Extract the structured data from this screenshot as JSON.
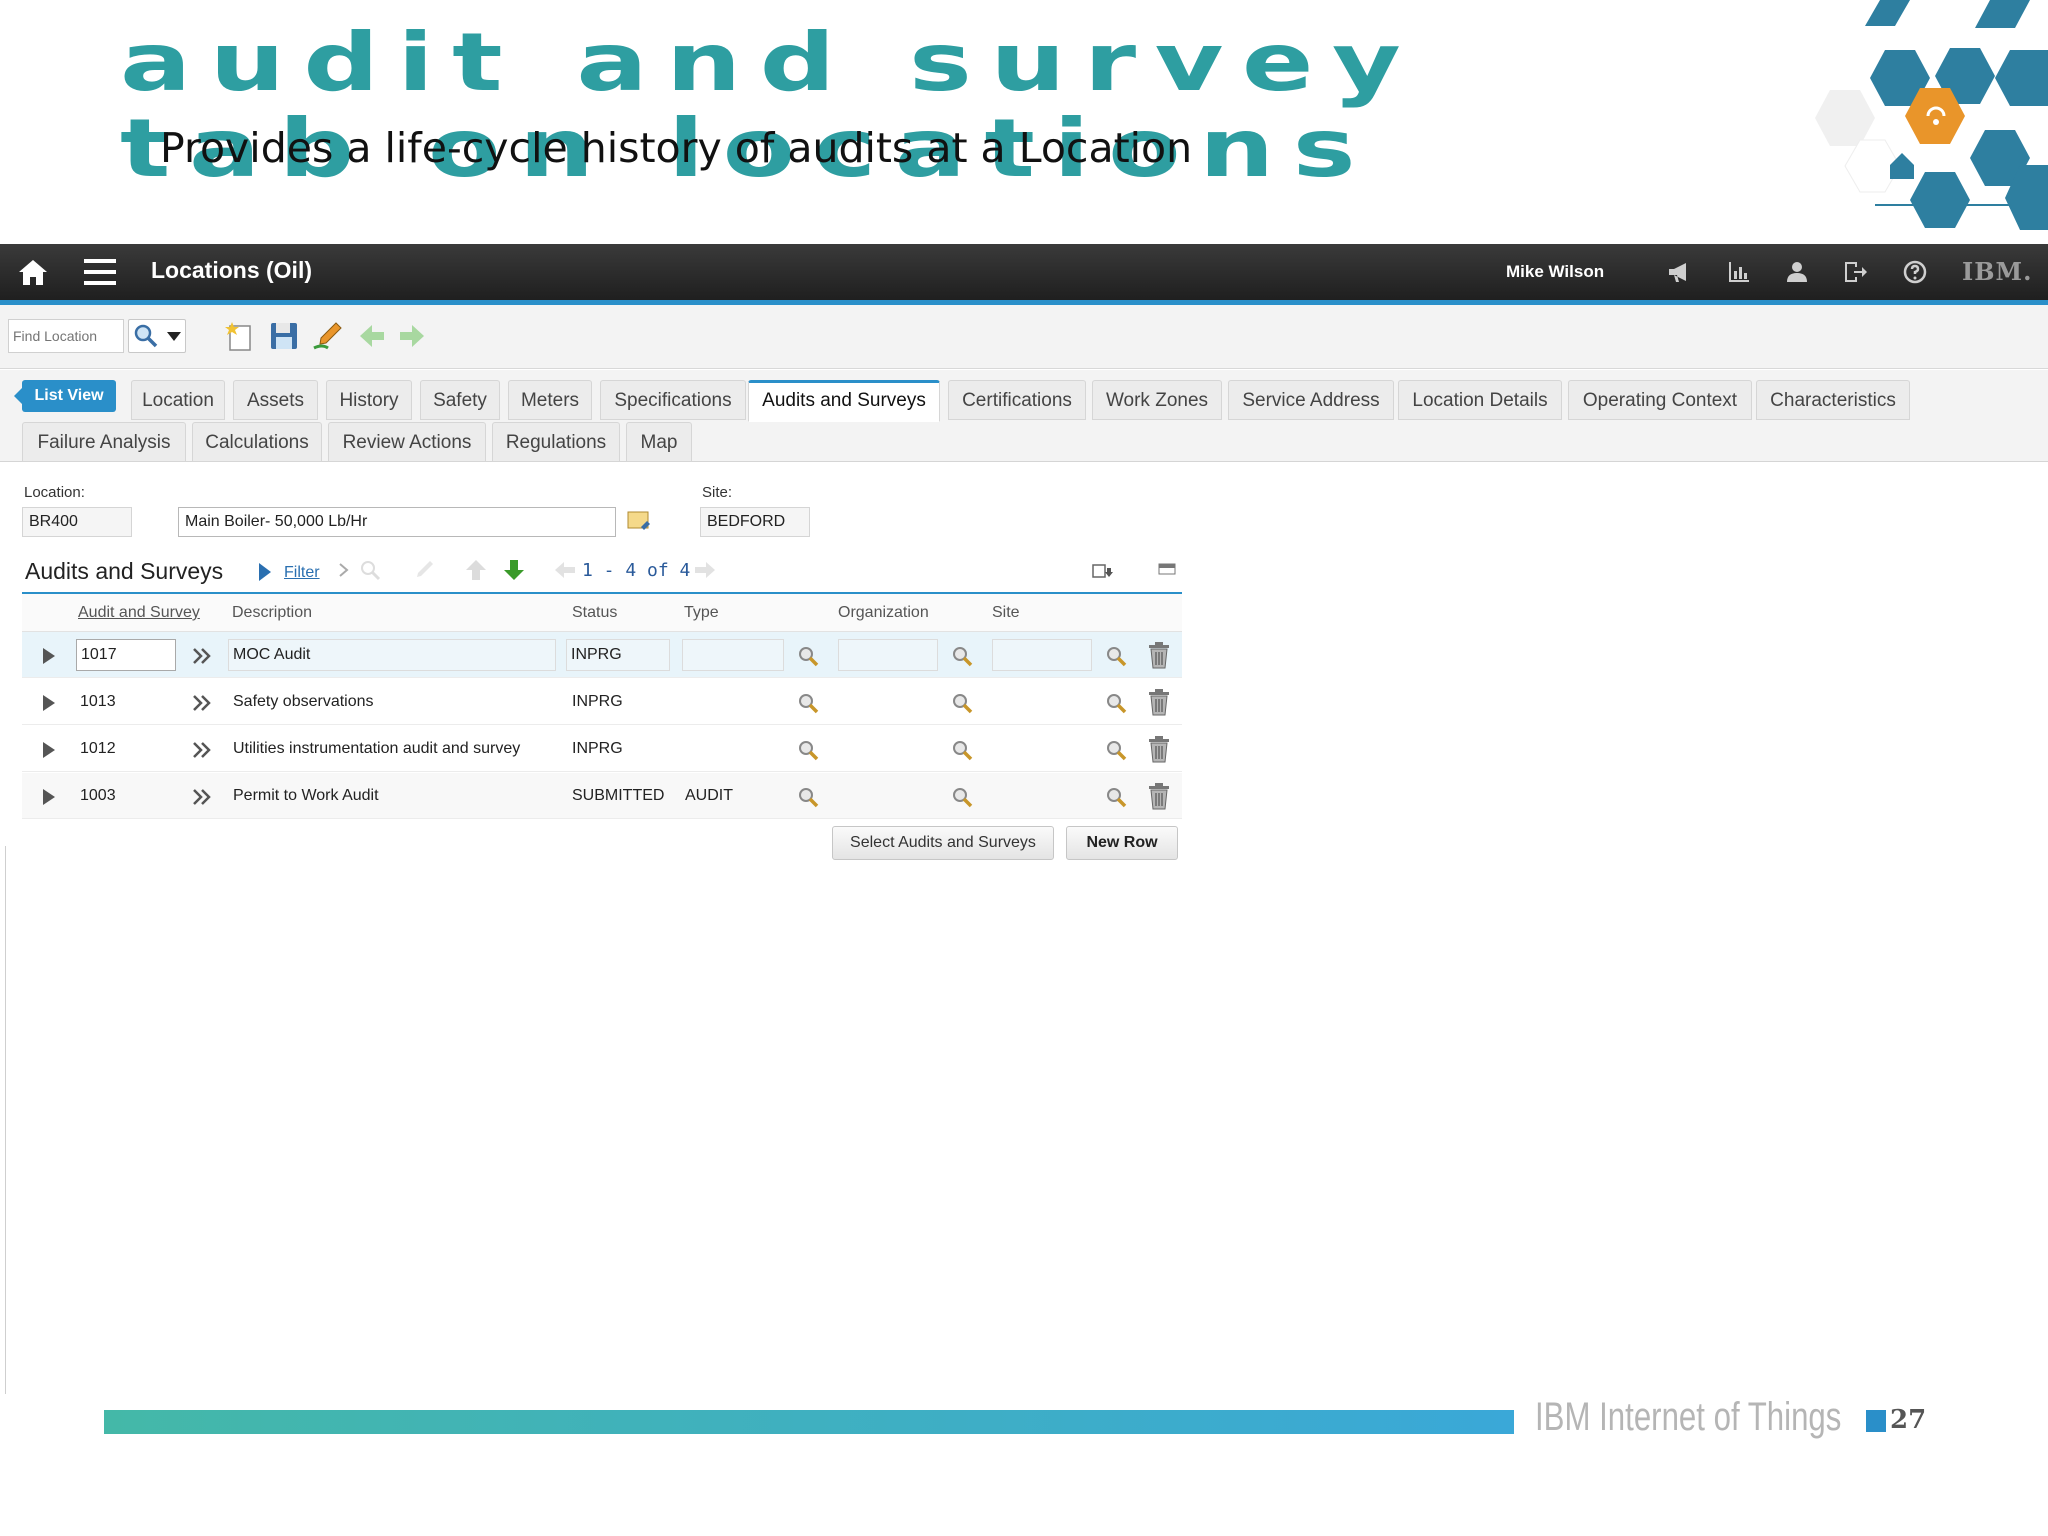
{
  "slide": {
    "title_line1": "audit and survey",
    "title_line2": "tab on locations",
    "subtitle": "Provides a life-cycle history of audits at a Location",
    "footer_brand": "IBM Internet of Things",
    "page_number": "27",
    "accent_color": "#2e9ea1"
  },
  "app": {
    "title": "Locations (Oil)",
    "user": "Mike Wilson",
    "logo": "IBM.",
    "accent_color": "#2a8fc9",
    "header_icons": [
      "megaphone-icon",
      "chart-icon",
      "user-icon",
      "logout-icon",
      "help-icon"
    ]
  },
  "toolbar": {
    "find_placeholder": "Find Location",
    "icons": [
      "search-icon",
      "new-record-icon",
      "save-icon",
      "clear-changes-icon",
      "previous-arrow-icon",
      "next-arrow-icon"
    ]
  },
  "tabs": {
    "list_view": "List View",
    "row1": [
      "Location",
      "Assets",
      "History",
      "Safety",
      "Meters",
      "Specifications",
      "Audits and Surveys",
      "Certifications",
      "Work Zones",
      "Service Address",
      "Location Details",
      "Operating Context",
      "Characteristics"
    ],
    "row2": [
      "Failure Analysis",
      "Calculations",
      "Review Actions",
      "Regulations",
      "Map"
    ],
    "active": "Audits and Surveys"
  },
  "form": {
    "location_label": "Location:",
    "location_value": "BR400",
    "description_value": "Main Boiler- 50,000 Lb/Hr",
    "site_label": "Site:",
    "site_value": "BEDFORD"
  },
  "audits": {
    "title": "Audits and Surveys",
    "filter": "Filter",
    "pager": "1 - 4 of 4",
    "columns": [
      "Audit and Survey",
      "Description",
      "Status",
      "Type",
      "Organization",
      "Site"
    ],
    "rows": [
      {
        "id": "1017",
        "description": "MOC Audit",
        "status": "INPRG",
        "type": "",
        "organization": "",
        "site": ""
      },
      {
        "id": "1013",
        "description": "Safety observations",
        "status": "INPRG",
        "type": "",
        "organization": "",
        "site": ""
      },
      {
        "id": "1012",
        "description": "Utilities instrumentation audit and survey",
        "status": "INPRG",
        "type": "",
        "organization": "",
        "site": ""
      },
      {
        "id": "1003",
        "description": "Permit to Work Audit",
        "status": "SUBMITTED",
        "type": "AUDIT",
        "organization": "",
        "site": ""
      }
    ],
    "select_button": "Select Audits and Surveys",
    "new_row_button": "New Row"
  }
}
